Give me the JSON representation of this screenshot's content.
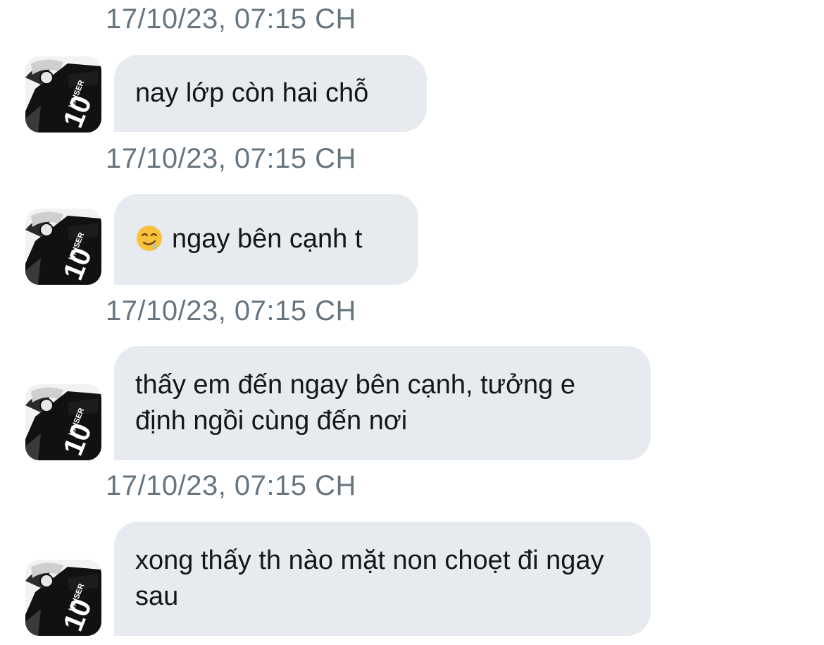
{
  "colors": {
    "bubble_bg": "#e7ebef",
    "timestamp_text": "#66757f",
    "message_text": "#14171a",
    "background": "#ffffff"
  },
  "messages": [
    {
      "timestamp": "17/10/23, 07:15 CH",
      "avatar_icon": "avatar-kaiser-10",
      "text": "nay lớp còn hai chỗ"
    },
    {
      "timestamp": "17/10/23, 07:15 CH",
      "avatar_icon": "avatar-kaiser-10",
      "emoji": "drooling-face",
      "text": "ngay bên cạnh t"
    },
    {
      "timestamp": "17/10/23, 07:15 CH",
      "avatar_icon": "avatar-kaiser-10",
      "text": "thấy em đến ngay bên cạnh, tưởng e định ngồi cùng đến nơi"
    },
    {
      "timestamp": "17/10/23, 07:15 CH",
      "avatar_icon": "avatar-kaiser-10",
      "text": "xong thấy th nào mặt non choẹt đi ngay sau"
    }
  ]
}
